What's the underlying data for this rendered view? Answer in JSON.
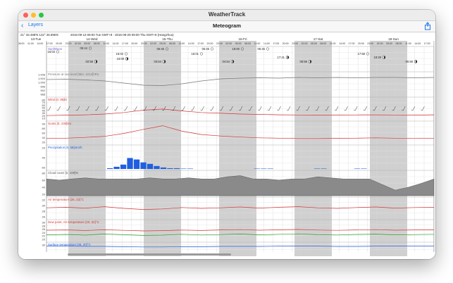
{
  "window": {
    "title": "WeatherTrack"
  },
  "nav": {
    "back_label": "Layers",
    "title": "Meteogram"
  },
  "location": {
    "coords": "21° 33.498'N 122° 26.995'E",
    "range": "2016-09-13 08:00 Tue GMT+8 - 2016-09-29 08:00 Thu GMT+8 (Hangzhou)"
  },
  "days": [
    {
      "label": "13-Tue",
      "shaded": false
    },
    {
      "label": "14-Wed",
      "shaded": true
    },
    {
      "label": "15-Thu",
      "shaded": true
    },
    {
      "label": "16-Fri",
      "shaded": true
    },
    {
      "label": "17-Sat",
      "shaded": true
    },
    {
      "label": "18-Sun",
      "shaded": true
    }
  ],
  "hour_ticks": [
    "08:00",
    "11:00",
    "14:00",
    "17:00",
    "20:00",
    "23:00",
    "02:00",
    "05:00"
  ],
  "sun_moon": [
    {
      "time": "16:03",
      "kind": "sun"
    },
    {
      "time": "05:44",
      "kind": "sun"
    },
    {
      "time": "02:58",
      "kind": "moon"
    },
    {
      "time": "16:02",
      "kind": "sun"
    },
    {
      "time": "16:08",
      "kind": "moon"
    },
    {
      "time": "03:54",
      "kind": "moon"
    },
    {
      "time": "05:45",
      "kind": "sun"
    },
    {
      "time": "16:01",
      "kind": "sun"
    },
    {
      "time": "05:45",
      "kind": "sun"
    },
    {
      "time": "04:54",
      "kind": "moon"
    },
    {
      "time": "18:00",
      "kind": "sun"
    },
    {
      "time": "05:45",
      "kind": "sun"
    },
    {
      "time": "17:41",
      "kind": "moon"
    },
    {
      "time": "05:56",
      "kind": "moon"
    },
    {
      "time": "17:58",
      "kind": "sun"
    },
    {
      "time": "18:28",
      "kind": "moon"
    },
    {
      "time": "06:58",
      "kind": "moon"
    }
  ],
  "panels": [
    {
      "id": "sunmoon",
      "label": "Sun/Moon",
      "color": "#6a5acd"
    },
    {
      "id": "pressure",
      "label": "Pressure at sea level [984, 1012]hPa",
      "color": "#777777",
      "ticks": [
        "1,008",
        "1,004",
        "1,000",
        "996",
        "992",
        "988"
      ]
    },
    {
      "id": "wind",
      "label": "Wind [0, 95]kt",
      "color": "#d33",
      "ticks": [
        "80",
        "70",
        "60",
        "50",
        "40",
        "30",
        "20",
        "10"
      ]
    },
    {
      "id": "gusts",
      "label": "Gusts [0, 100]km",
      "color": "#d33",
      "ticks": [
        "90",
        "80",
        "60",
        "40",
        "20"
      ]
    },
    {
      "id": "precip",
      "label": "Precipitation [0, 58]mm/h",
      "color": "#1f5fe0",
      "ticks": [
        "20",
        "40",
        "60"
      ]
    },
    {
      "id": "cloud",
      "label": "Cloud cover [0, 100]%",
      "color": "#555555",
      "ticks": [
        "80",
        "60",
        "40",
        "20"
      ]
    },
    {
      "id": "airtemp",
      "label": "Air temperature [26, 32]°C",
      "color": "#d33",
      "ticks": [
        "32",
        "30",
        "28",
        "26"
      ]
    },
    {
      "id": "dewpoint",
      "label": "Dew point, Air temperature [20, 32]°C",
      "color": "#d33",
      "ticks": [
        "30",
        "28",
        "26",
        "24",
        "22",
        "20"
      ]
    },
    {
      "id": "surface",
      "label": "Surface temperature [28, 30]°C",
      "color": "#1f5fe0",
      "ticks": [
        "30"
      ]
    }
  ],
  "icons": {
    "back": "chevron-left-icon",
    "share": "share-icon"
  },
  "colors": {
    "accent": "#1a73e8",
    "red": "#d33333",
    "blue": "#1f5fe0",
    "green": "#2a9d2a",
    "cloud": "#8a8a8a",
    "night": "#c8c8c8"
  },
  "chart_data": [
    {
      "type": "line",
      "ylabel": "Pressure at sea level [984, 1012]hPa",
      "ylim": [
        984,
        1012
      ],
      "series": [
        {
          "values": [
            1005,
            1005.5,
            1004.5,
            1003,
            1000,
            997,
            996.5,
            999,
            1003,
            1006,
            1007,
            1007.5,
            1007,
            1008,
            1007.5,
            1008,
            1007.5,
            1008,
            1008,
            1007.5,
            1008
          ]
        }
      ]
    },
    {
      "type": "line",
      "ylabel": "Wind [0, 95]kt",
      "ylim": [
        0,
        95
      ],
      "series": [
        {
          "values": [
            14,
            16,
            18,
            22,
            30,
            42,
            48,
            38,
            30,
            26,
            22,
            20,
            18,
            17,
            16,
            16,
            17,
            18,
            17,
            16,
            18
          ]
        }
      ]
    },
    {
      "type": "line",
      "ylabel": "Gusts [0, 100]km",
      "ylim": [
        0,
        100
      ],
      "series": [
        {
          "values": [
            20,
            22,
            26,
            32,
            48,
            70,
            90,
            60,
            42,
            34,
            28,
            24,
            22,
            20,
            20,
            21,
            22,
            24,
            22,
            20,
            22
          ]
        }
      ]
    },
    {
      "type": "bar",
      "ylabel": "Precipitation [0, 58]mm/h",
      "ylim": [
        0,
        58
      ],
      "values": [
        0,
        0,
        0,
        0,
        0,
        0,
        0,
        0,
        0,
        2,
        6,
        12,
        30,
        26,
        18,
        14,
        8,
        4,
        2,
        2,
        1,
        1,
        0,
        0,
        0,
        0,
        0,
        0,
        0,
        0,
        0,
        1,
        1,
        1,
        0,
        0,
        0,
        0,
        0,
        0,
        1,
        1,
        0,
        0,
        0,
        0,
        1,
        1,
        0,
        0,
        0,
        0,
        0,
        0,
        0,
        0,
        0,
        0
      ]
    },
    {
      "type": "area",
      "ylabel": "Cloud cover [0, 100]%",
      "ylim": [
        0,
        100
      ],
      "series": [
        {
          "values": [
            30,
            28,
            30,
            32,
            30,
            30,
            30,
            30,
            32,
            30,
            30,
            32,
            30,
            30,
            34,
            36,
            30,
            30,
            28,
            30,
            30,
            34,
            32,
            30,
            30,
            30,
            20,
            10,
            15,
            22,
            30
          ]
        }
      ]
    },
    {
      "type": "line",
      "ylabel": "Air temperature [26, 32]°C",
      "ylim": [
        26,
        32
      ],
      "series": [
        {
          "values": [
            29.2,
            29.4,
            29.1,
            29.6,
            29.0,
            28.6,
            28.8,
            29.3,
            29.0,
            29.2,
            29.5,
            29.1,
            29.4,
            29.6,
            29.2,
            29.0,
            29.3,
            29.5,
            29.1,
            29.3,
            29.4
          ]
        }
      ]
    },
    {
      "type": "line",
      "ylabel": "Dew point, Air temperature [20, 32]°C",
      "ylim": [
        20,
        32
      ],
      "series": [
        {
          "values": [
            26.5,
            26.7,
            26.3,
            26.8,
            26.4,
            26.0,
            26.2,
            26.6,
            26.3,
            26.7,
            26.9,
            26.5,
            26.8,
            27.0,
            26.6,
            26.4,
            26.7,
            26.9,
            26.5,
            26.7,
            26.8
          ]
        },
        {
          "values": [
            23.2,
            23.5,
            23.0,
            23.8,
            23.3,
            22.8,
            23.0,
            23.6,
            23.1,
            23.4,
            23.8,
            23.2,
            23.6,
            23.9,
            23.3,
            23.1,
            23.5,
            23.7,
            23.2,
            23.4,
            23.6
          ]
        }
      ]
    },
    {
      "type": "line",
      "ylabel": "Surface temperature [28, 30]°C",
      "ylim": [
        28,
        30
      ],
      "series": [
        {
          "values": [
            29.6,
            29.6,
            29.5,
            29.5,
            29.4,
            29.3,
            29.3,
            29.4,
            29.4,
            29.5,
            29.5,
            29.5,
            29.6,
            29.6,
            29.6,
            29.5,
            29.5,
            29.6,
            29.6,
            29.6,
            29.6
          ]
        }
      ]
    }
  ]
}
